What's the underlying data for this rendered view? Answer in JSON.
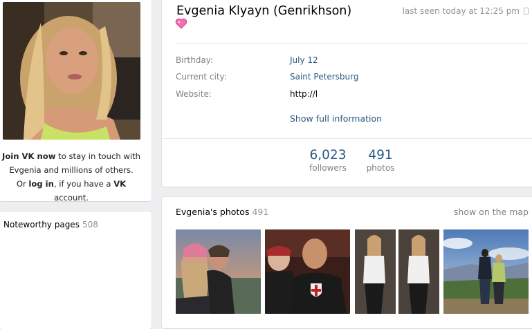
{
  "sidebar": {
    "join_bold": "Join VK now",
    "join_rest": " to stay in touch with",
    "join_line2": "Evgenia and millions of others.",
    "or_text": "Or ",
    "login": "log in",
    "if_text": ", if you have a ",
    "vk": "VK",
    "account": " account.",
    "noteworthy_label": "Noteworthy pages",
    "noteworthy_count": "508"
  },
  "profile": {
    "name": "Evgenia Klyayn (Genrikhson)",
    "status_icon": "sparkling-heart-icon",
    "last_seen": "last seen today at 12:25 pm",
    "info": [
      {
        "label": "Birthday:",
        "value": "July 12",
        "is_link": true
      },
      {
        "label": "Current city:",
        "value": "Saint Petersburg",
        "is_link": true
      },
      {
        "label": "Website:",
        "value": "http://l",
        "is_link": false
      }
    ],
    "show_full": "Show full information",
    "counters": [
      {
        "num": "6,023",
        "label": "followers"
      },
      {
        "num": "491",
        "label": "photos"
      }
    ]
  },
  "photos": {
    "title": "Evgenia's photos",
    "count": "491",
    "show_on_map": "show on the map"
  },
  "colors": {
    "link": "#2a5885",
    "muted": "#828282",
    "background": "#edeef0"
  }
}
